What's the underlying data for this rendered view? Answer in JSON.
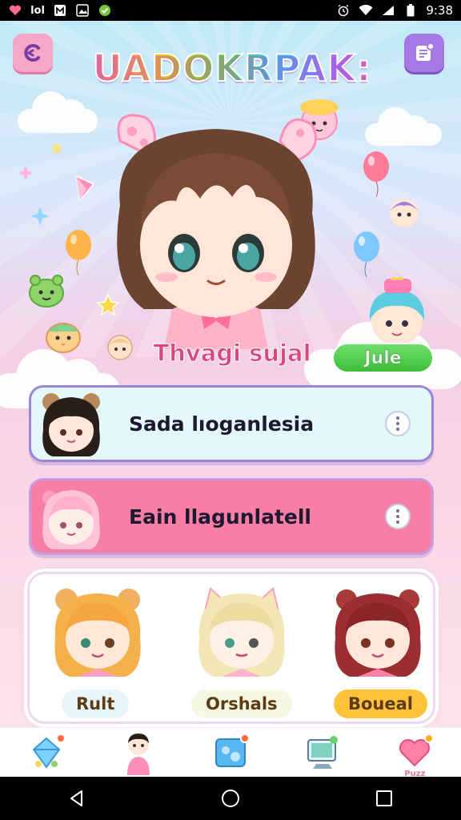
{
  "status_bar": {
    "left_icons": [
      "heart-notification-icon",
      "lol-app-icon",
      "m-app-icon",
      "image-icon",
      "shield-check-icon"
    ],
    "lol_label": "lol",
    "right_icons": [
      "alarm-icon",
      "wifi-icon",
      "signal-icon",
      "battery-icon"
    ],
    "time": "9:38"
  },
  "header": {
    "back_icon": "back-icon",
    "title": "UADOKRPAK:",
    "menu_icon": "notes-icon"
  },
  "profile": {
    "name": "Thvagi sujal",
    "status": "Jule"
  },
  "cards": [
    {
      "title": "Sada lıoganlesia",
      "theme": "#e4f8fb",
      "avatar": "dark-hair-bear-ear-avatar"
    },
    {
      "title": "Eain llagunlatell",
      "theme": "#f77fa6",
      "avatar": "pink-hair-avatar"
    }
  ],
  "friends": [
    {
      "label": "Rult",
      "avatar": "orange-hair-bear-avatar",
      "pill_color": "#e8f6fb"
    },
    {
      "label": "Orshals",
      "avatar": "blonde-cat-avatar",
      "pill_color": "#f6f8e4"
    },
    {
      "label": "Boueal",
      "avatar": "red-hair-avatar",
      "pill_color": "#ffc23a"
    }
  ],
  "bottom_nav": [
    {
      "icon": "crystal-icon",
      "label": ""
    },
    {
      "icon": "profile-character-icon",
      "label": ""
    },
    {
      "icon": "photo-card-icon",
      "label": ""
    },
    {
      "icon": "computer-icon",
      "label": ""
    },
    {
      "icon": "heart-icon",
      "label": "Puzz"
    }
  ],
  "system_nav": [
    "back-triangle-icon",
    "home-circle-icon",
    "recents-square-icon"
  ],
  "colors": {
    "accent_pink": "#f77fa6",
    "accent_purple": "#a678e6",
    "status_green": "#3cbf3a",
    "name_pink": "#d9477c"
  }
}
